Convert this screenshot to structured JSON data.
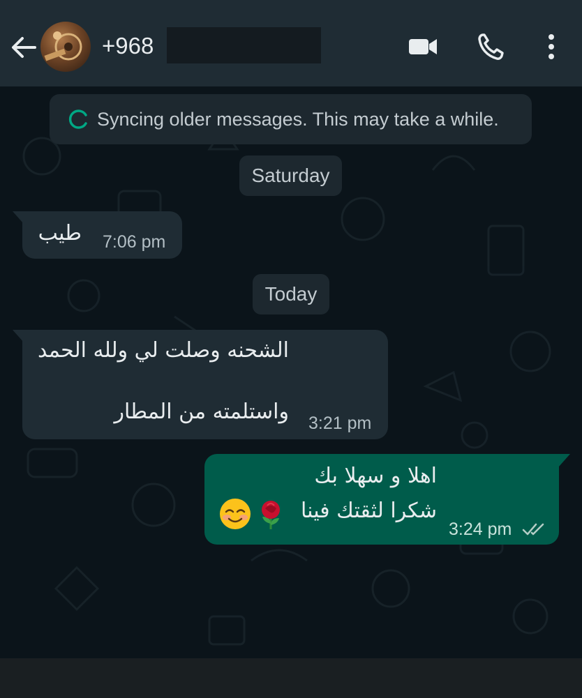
{
  "header": {
    "contact_number": "+968",
    "icons": [
      "back-arrow-icon",
      "video-call-icon",
      "voice-call-icon",
      "more-options-icon"
    ]
  },
  "sync_notice": {
    "text": "Syncing older messages. This may take a while.",
    "icon": "sync-spinner-icon"
  },
  "dates": {
    "first": "Saturday",
    "second": "Today"
  },
  "messages": [
    {
      "direction": "incoming",
      "lines": [
        "طيب"
      ],
      "time": "7:06 pm"
    },
    {
      "direction": "incoming",
      "lines": [
        "الشحنه وصلت لي ولله الحمد",
        "واستلمته من المطار"
      ],
      "time": "3:21 pm"
    },
    {
      "direction": "outgoing",
      "lines": [
        "اهلا و سهلا بك",
        "شكرا لثقتك فينا"
      ],
      "emojis": [
        "rose-emoji",
        "smiling-face-emoji"
      ],
      "time": "3:24 pm",
      "status_icon": "double-check-icon"
    }
  ],
  "colors": {
    "header": "#1f2c34",
    "background": "#0b141a",
    "incoming_bubble": "#1f2c34",
    "outgoing_bubble": "#005c4b",
    "accent": "#00a884"
  }
}
